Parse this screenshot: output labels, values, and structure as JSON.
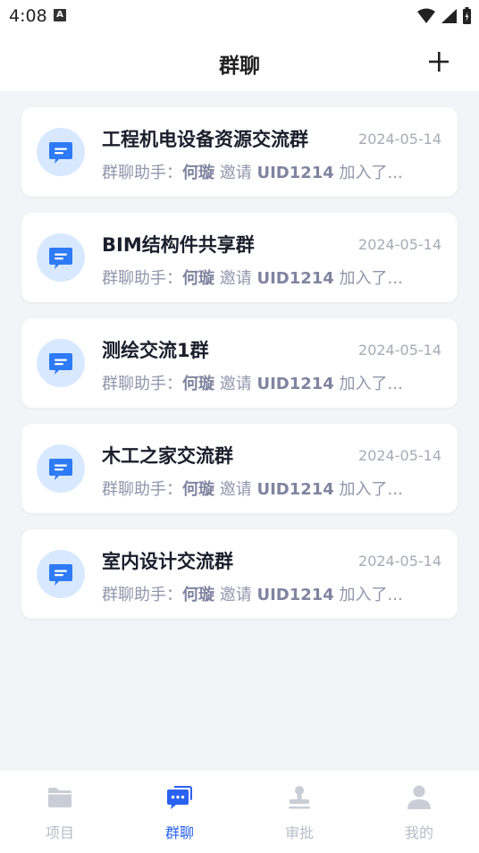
{
  "status_bar": {
    "time": "4:08",
    "badge": "A"
  },
  "header": {
    "title": "群聊",
    "add_icon": "plus-icon"
  },
  "groups": [
    {
      "name": "工程机电设备资源交流群",
      "date": "2024-05-14",
      "msg_prefix": "群聊助手：",
      "inviter": "何璇",
      "verb": " 邀请 ",
      "invitee": "UID1214",
      "msg_suffix": " 加入了..."
    },
    {
      "name": "BIM结构件共享群",
      "date": "2024-05-14",
      "msg_prefix": "群聊助手：",
      "inviter": "何璇",
      "verb": " 邀请 ",
      "invitee": "UID1214",
      "msg_suffix": " 加入了..."
    },
    {
      "name": "测绘交流1群",
      "date": "2024-05-14",
      "msg_prefix": "群聊助手：",
      "inviter": "何璇",
      "verb": " 邀请 ",
      "invitee": "UID1214",
      "msg_suffix": " 加入了..."
    },
    {
      "name": "木工之家交流群",
      "date": "2024-05-14",
      "msg_prefix": "群聊助手：",
      "inviter": "何璇",
      "verb": " 邀请 ",
      "invitee": "UID1214",
      "msg_suffix": " 加入了..."
    },
    {
      "name": "室内设计交流群",
      "date": "2024-05-14",
      "msg_prefix": "群聊助手：",
      "inviter": "何璇",
      "verb": " 邀请 ",
      "invitee": "UID1214",
      "msg_suffix": " 加入了..."
    }
  ],
  "tabs": [
    {
      "label": "项目",
      "icon": "folder-icon",
      "active": false
    },
    {
      "label": "群聊",
      "icon": "chat-icon",
      "active": true
    },
    {
      "label": "审批",
      "icon": "stamp-icon",
      "active": false
    },
    {
      "label": "我的",
      "icon": "user-icon",
      "active": false
    }
  ],
  "colors": {
    "accent": "#2a62f0",
    "inactive": "#b7bcc7",
    "avatar_bg": "#d8e9ff",
    "chat_icon": "#2f7af5"
  }
}
